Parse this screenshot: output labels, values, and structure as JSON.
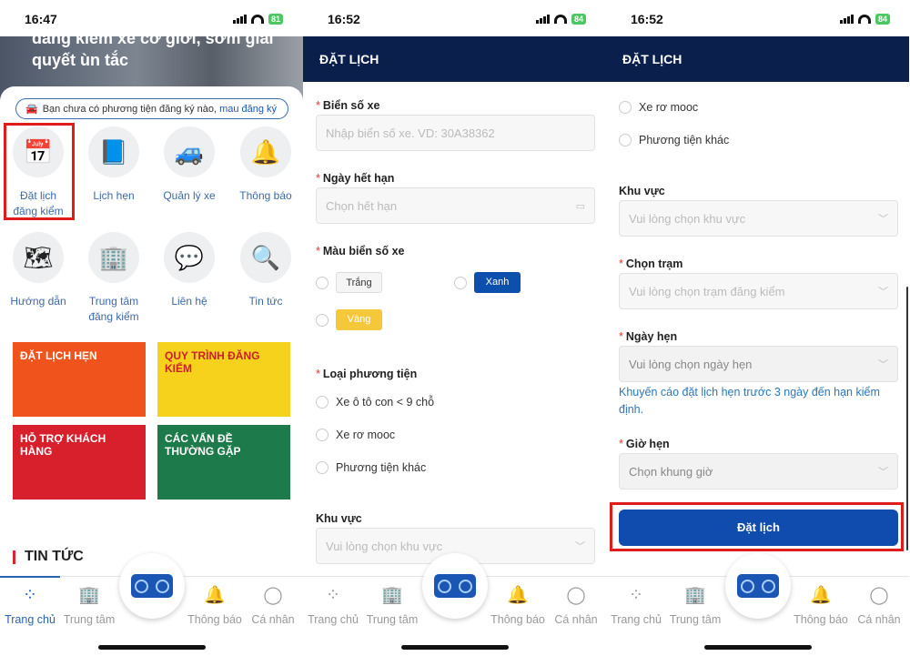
{
  "colors": {
    "accent": "#1c56b5",
    "header": "#0b1f4d",
    "highlight": "#e01b1b",
    "hint": "#2c77b8",
    "button": "#0f4cad"
  },
  "screens": [
    {
      "time": "16:47",
      "battery": "81"
    },
    {
      "time": "16:52",
      "battery": "84"
    },
    {
      "time": "16:52",
      "battery": "84"
    }
  ],
  "home": {
    "hero_line1": "đăng kiểm xe cơ giới, sớm giải",
    "hero_line2": "quyết ùn tắc",
    "notice_text": "Bạn chưa có phương tiện đăng ký nào,",
    "notice_link": "mau đăng ký",
    "tiles": [
      {
        "label1": "Đặt lịch",
        "label2": "đăng kiểm",
        "icon": "calendar-clock-icon"
      },
      {
        "label1": "Lịch hẹn",
        "label2": "",
        "icon": "notebook-icon"
      },
      {
        "label1": "Quản lý xe",
        "label2": "",
        "icon": "car-icon"
      },
      {
        "label1": "Thông báo",
        "label2": "",
        "icon": "bell-icon"
      },
      {
        "label1": "Hướng dẫn",
        "label2": "",
        "icon": "guide-map-icon"
      },
      {
        "label1": "Trung tâm",
        "label2": "đăng kiểm",
        "icon": "building-icon"
      },
      {
        "label1": "Liên hệ",
        "label2": "",
        "icon": "chat-bubbles-icon"
      },
      {
        "label1": "Tin tức",
        "label2": "",
        "icon": "magnifier-check-icon"
      }
    ],
    "banners": [
      {
        "text": "ĐẶT LỊCH HẸN",
        "color": "#f0531c"
      },
      {
        "text": "QUY TRÌNH ĐĂNG KIỂM",
        "color": "#f7d21c"
      },
      {
        "text": "HỖ TRỢ KHÁCH HÀNG",
        "color": "#d8202c"
      },
      {
        "text": "CÁC VẤN ĐỀ THƯỜNG GẶP",
        "color": "#1d7a4a"
      }
    ],
    "news_title": "TIN TỨC"
  },
  "nav": [
    {
      "label": "Trang chủ",
      "icon": "grid-icon"
    },
    {
      "label": "Trung tâm",
      "icon": "building-icon"
    },
    {
      "label": "Thông báo",
      "icon": "bell-icon"
    },
    {
      "label": "Cá nhân",
      "icon": "user-icon"
    }
  ],
  "form": {
    "title": "ĐẶT LỊCH",
    "plate_label": "Biển số xe",
    "plate_placeholder": "Nhập biển số xe. VD: 30A38362",
    "expiry_label": "Ngày hết hạn",
    "expiry_placeholder": "Chọn hết hạn",
    "plate_color_label": "Màu biển số xe",
    "plate_colors": [
      {
        "label": "Trắng",
        "color": "#f5f5f5"
      },
      {
        "label": "Xanh",
        "color": "#0d4fad"
      },
      {
        "label": "Vàng",
        "color": "#f5c73b"
      }
    ],
    "vehicle_type_label": "Loại phương tiện",
    "vehicle_types": [
      "Xe ô tô con < 9 chỗ",
      "Xe rơ mooc",
      "Phương tiện khác"
    ],
    "region_label": "Khu vực",
    "region_placeholder": "Vui lòng chọn khu vực",
    "station_label": "Chọn trạm",
    "station_placeholder": "Vui lòng chọn trạm đăng kiểm",
    "date_label": "Ngày hẹn",
    "date_placeholder": "Vui lòng chọn ngày hẹn",
    "hint": "Khuyến cáo đặt lịch hẹn trước 3 ngày đến hạn kiểm định.",
    "time_label": "Giờ hẹn",
    "time_placeholder": "Chọn khung giờ",
    "submit": "Đặt lịch"
  }
}
